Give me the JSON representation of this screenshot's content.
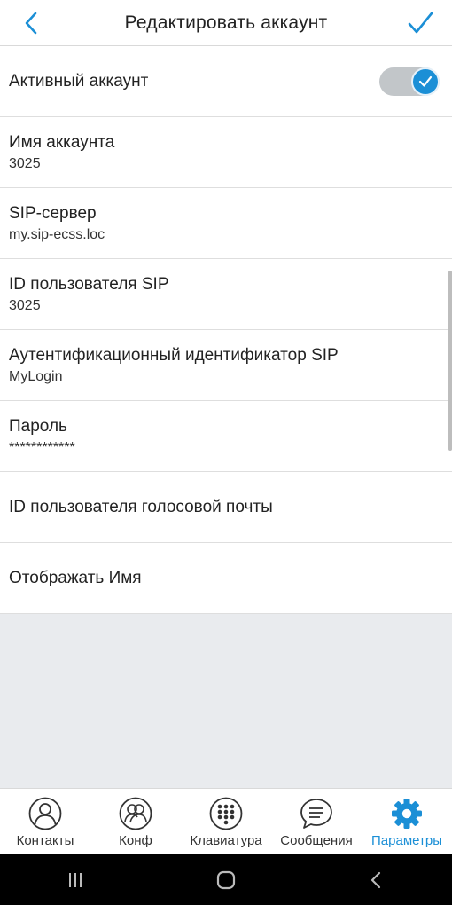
{
  "header": {
    "title": "Редактировать аккаунт",
    "back_icon": "chevron-left-icon",
    "confirm_icon": "check-icon"
  },
  "colors": {
    "accent": "#1b8fd6",
    "toggle_track": "#c2c6c9",
    "background": "#e9ebee"
  },
  "settings": {
    "active_account": {
      "label": "Активный аккаунт",
      "enabled": true
    },
    "account_name": {
      "label": "Имя аккаунта",
      "value": "3025"
    },
    "sip_server": {
      "label": "SIP-сервер",
      "value": "my.sip-ecss.loc"
    },
    "sip_user_id": {
      "label": "ID пользователя SIP",
      "value": "3025"
    },
    "sip_auth_id": {
      "label": "Аутентификационный идентификатор SIP",
      "value": "MyLogin"
    },
    "password": {
      "label": "Пароль",
      "value": "************"
    },
    "voicemail_user_id": {
      "label": "ID пользователя голосовой почты"
    },
    "display_name": {
      "label": "Отображать Имя"
    }
  },
  "bottom_nav": {
    "items": [
      {
        "label": "Контакты",
        "icon": "person-icon",
        "active": false
      },
      {
        "label": "Конф",
        "icon": "group-icon",
        "active": false
      },
      {
        "label": "Клавиатура",
        "icon": "dialpad-icon",
        "active": false
      },
      {
        "label": "Сообщения",
        "icon": "chat-icon",
        "active": false
      },
      {
        "label": "Параметры",
        "icon": "gear-icon",
        "active": true
      }
    ]
  },
  "system_nav": {
    "recents_icon": "recents-icon",
    "home_icon": "home-icon",
    "back_icon": "back-icon"
  }
}
